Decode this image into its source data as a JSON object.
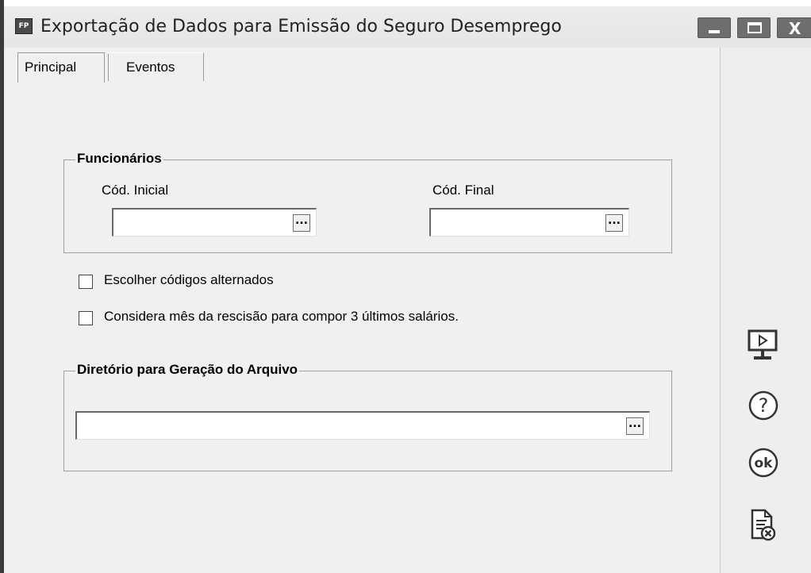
{
  "window": {
    "app_icon": "FP",
    "title": "Exportação de Dados para Emissão do Seguro Desemprego"
  },
  "tabs": [
    {
      "label": "Principal",
      "active": true
    },
    {
      "label": "Eventos",
      "active": false
    }
  ],
  "funcionarios": {
    "title": "Funcionários",
    "cod_inicial": {
      "label": "Cód. Inicial",
      "value": ""
    },
    "cod_final": {
      "label": "Cód. Final",
      "value": ""
    },
    "lookup_button": "..."
  },
  "options": {
    "escolher_codigos": {
      "label": "Escolher códigos alternados",
      "checked": false
    },
    "considera_mes": {
      "label": "Considera mês da rescisão para compor 3 últimos salários.",
      "checked": false
    }
  },
  "diretorio": {
    "title": "Diretório para Geração do Arquivo",
    "value": "",
    "browse_button": "..."
  },
  "sidebar": {
    "icons": [
      "preview-monitor-icon",
      "help-icon",
      "ok-icon",
      "cancel-document-icon"
    ],
    "ok_text": "ok",
    "help_text": "?"
  }
}
